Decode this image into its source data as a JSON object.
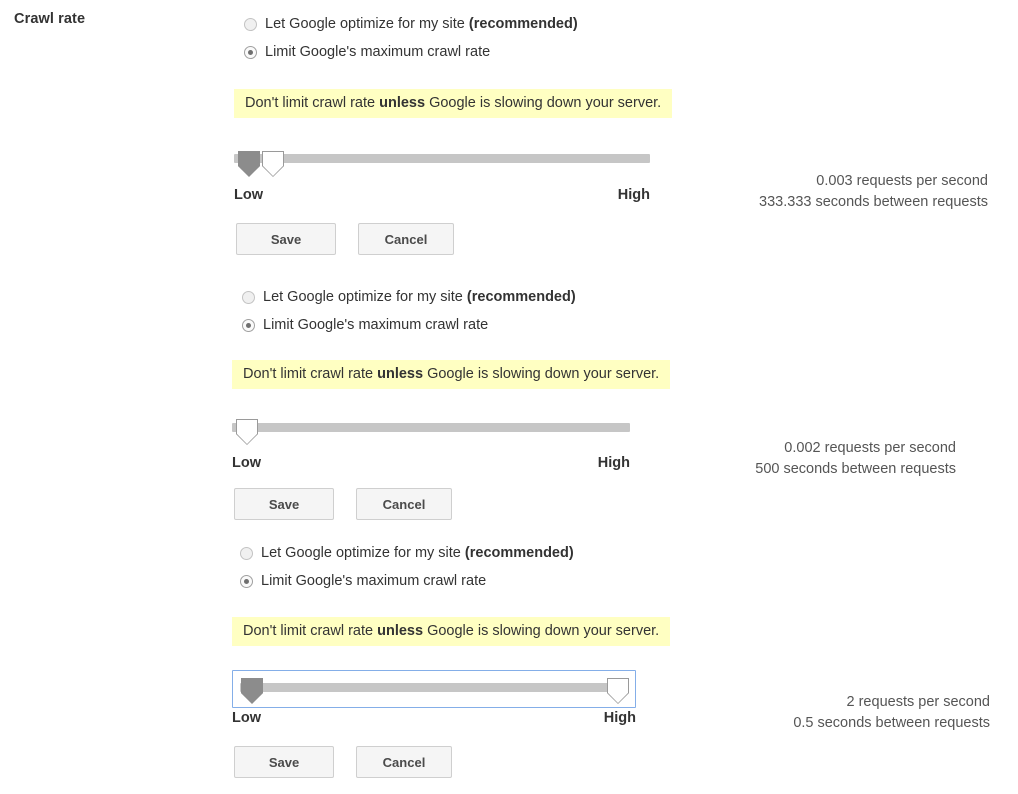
{
  "page": {
    "section_label": "Crawl rate"
  },
  "common": {
    "option_optimize_prefix": "Let Google optimize for my site ",
    "option_optimize_bold": "(recommended)",
    "option_limit": "Limit Google's maximum crawl rate",
    "warning_prefix": "Don't limit crawl rate ",
    "warning_bold": "unless",
    "warning_suffix": " Google is slowing down your server.",
    "low_label": "Low",
    "high_label": "High",
    "save_label": "Save",
    "cancel_label": "Cancel",
    "accent_blue": "#84aee8",
    "warning_bg": "#ffffc2",
    "track_color": "#c6c6c6",
    "handle_fill": "#8c8c8c"
  },
  "panels": [
    {
      "id": "panel-1",
      "selected_option": "limit",
      "requests_per_second": "0.003 requests per second",
      "seconds_between": "333.333 seconds between requests",
      "slider": {
        "handles": [
          {
            "type": "filled",
            "position_pct": 0
          },
          {
            "type": "hollow",
            "position_pct": 4
          }
        ],
        "focused": false
      }
    },
    {
      "id": "panel-2",
      "selected_option": "limit",
      "requests_per_second": "0.002 requests per second",
      "seconds_between": "500 seconds between requests",
      "slider": {
        "handles": [
          {
            "type": "hollow",
            "position_pct": 0
          }
        ],
        "focused": false
      }
    },
    {
      "id": "panel-3",
      "selected_option": "limit",
      "requests_per_second": "2 requests per second",
      "seconds_between": "0.5 seconds between requests",
      "slider": {
        "handles": [
          {
            "type": "filled",
            "position_pct": 0
          },
          {
            "type": "hollow",
            "position_pct": 100
          }
        ],
        "focused": true
      }
    }
  ]
}
